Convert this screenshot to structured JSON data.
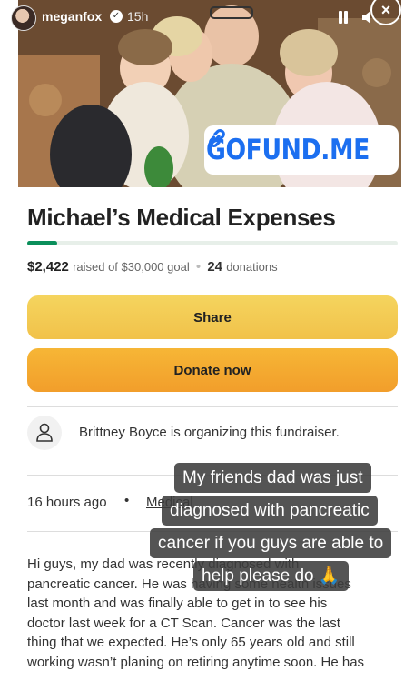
{
  "story_header": {
    "username": "meganfox",
    "verified_glyph": "✓",
    "timestamp": "15h",
    "close_glyph": "×"
  },
  "photo": {
    "badge_text": "GOFUND.ME",
    "badge_color": "#1c6ff0"
  },
  "fundraiser": {
    "title": "Michael’s Medical Expenses",
    "raised_amount": "$2,422",
    "raised_label": "raised of $30,000 goal",
    "separator": "•",
    "donation_count": "24",
    "donations_label": "donations",
    "progress_fraction": 0.0807,
    "accent": "#0a8f5b"
  },
  "buttons": {
    "share_label": "Share",
    "donate_label": "Donate now",
    "share_color": "#f3cc54",
    "donate_color": "#f4a930"
  },
  "organizer": {
    "text": "Brittney Boyce is organizing this fundraiser."
  },
  "meta": {
    "posted": "16 hours ago",
    "bullet": "•",
    "category": "Medical"
  },
  "story": {
    "lines": [
      "Hi guys, my dad was recently diagnosed with",
      "pancreatic cancer. He was having some health issues",
      "last month and was finally able to get in to see his",
      "doctor last week for a CT Scan. Cancer was the last",
      "thing that we expected. He’s only 65 years old and still",
      "working wasn’t planing on retiring anytime soon. He has"
    ]
  },
  "caption": {
    "lines": [
      "My friends dad was just",
      "diagnosed with pancreatic",
      "cancer if you guys are able to",
      "help please do 🙏"
    ]
  }
}
